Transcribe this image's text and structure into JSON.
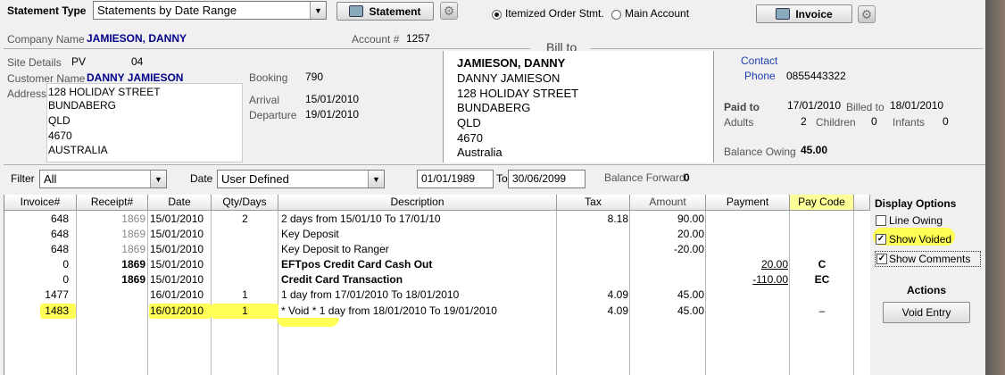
{
  "top": {
    "statement_type_label": "Statement Type",
    "statement_type_value": "Statements by Date Range",
    "statement_button": "Statement",
    "radio_itemized": "Itemized Order Stmt.",
    "radio_main": "Main Account",
    "invoice_button": "Invoice"
  },
  "company": {
    "label": "Company Name",
    "value": "JAMIESON, DANNY"
  },
  "account": {
    "label": "Account #",
    "value": "1257"
  },
  "bill_to_title": "Bill to",
  "site": {
    "label": "Site Details",
    "code": "PV",
    "number": "04"
  },
  "customer": {
    "label": "Customer Name",
    "value": "DANNY JAMIESON"
  },
  "address": {
    "label": "Address",
    "lines": [
      "128 HOLIDAY STREET",
      "BUNDABERG",
      "QLD",
      "4670",
      "AUSTRALIA"
    ]
  },
  "booking": {
    "label": "Booking",
    "value": "790"
  },
  "arrival": {
    "label": "Arrival",
    "value": "15/01/2010"
  },
  "departure": {
    "label": "Departure",
    "value": "19/01/2010"
  },
  "bill_to": {
    "name": "JAMIESON, DANNY",
    "lines": [
      "DANNY JAMIESON",
      "128 HOLIDAY STREET",
      "BUNDABERG",
      "QLD",
      "4670",
      "Australia"
    ]
  },
  "contact": {
    "label": "Contact",
    "phone_label": "Phone",
    "phone": "0855443322"
  },
  "paid": {
    "paid_to_label": "Paid to",
    "paid_to": "17/01/2010",
    "billed_to_label": "Billed to",
    "billed_to": "18/01/2010",
    "adults_label": "Adults",
    "adults": "2",
    "children_label": "Children",
    "children": "0",
    "infants_label": "Infants",
    "infants": "0",
    "balance_owing_label": "Balance Owing",
    "balance_owing": "45.00"
  },
  "filter": {
    "label": "Filter",
    "value": "All",
    "date_label": "Date",
    "date_value": "User Defined",
    "from": "01/01/1989",
    "to_label": "To",
    "to": "30/06/2099",
    "balance_forward_label": "Balance Forward",
    "balance_forward": "0"
  },
  "table": {
    "headers": [
      "Invoice#",
      "Receipt#",
      "Date",
      "Qty/Days",
      "Description",
      "Tax",
      "Amount",
      "Payment",
      "Pay Code"
    ],
    "rows": [
      {
        "invoice": "648",
        "receipt": "1869",
        "date": "15/01/2010",
        "qty": "2",
        "desc": "2 days from 15/01/10 To 17/01/10",
        "tax": "8.18",
        "amount": "90.00",
        "payment": "",
        "paycode": ""
      },
      {
        "invoice": "648",
        "receipt": "1869",
        "date": "15/01/2010",
        "qty": "",
        "desc": "Key Deposit",
        "tax": "",
        "amount": "20.00",
        "payment": "",
        "paycode": ""
      },
      {
        "invoice": "648",
        "receipt": "1869",
        "date": "15/01/2010",
        "qty": "",
        "desc": "Key Deposit to Ranger",
        "tax": "",
        "amount": "-20.00",
        "payment": "",
        "paycode": ""
      },
      {
        "invoice": "0",
        "receipt": "1869",
        "date": "15/01/2010",
        "qty": "",
        "desc": "EFTpos Credit Card Cash Out",
        "tax": "",
        "amount": "",
        "payment": "20.00",
        "paycode": "C"
      },
      {
        "invoice": "0",
        "receipt": "1869",
        "date": "15/01/2010",
        "qty": "",
        "desc": "Credit Card Transaction",
        "tax": "",
        "amount": "",
        "payment": "-110.00",
        "paycode": "EC"
      },
      {
        "invoice": "1477",
        "receipt": "",
        "date": "16/01/2010",
        "qty": "1",
        "desc": "1 day from 17/01/2010 To 18/01/2010",
        "tax": "4.09",
        "amount": "45.00",
        "payment": "",
        "paycode": ""
      },
      {
        "invoice": "1483",
        "receipt": "",
        "date": "16/01/2010",
        "qty": "1",
        "desc": "* Void * 1 day from 18/01/2010 To 19/01/2010",
        "tax": "4.09",
        "amount": "45.00",
        "payment": "",
        "paycode": "–"
      }
    ]
  },
  "display_options": {
    "title": "Display Options",
    "line_owing": "Line Owing",
    "show_voided": "Show Voided",
    "show_comments": "Show  Comments",
    "actions_title": "Actions",
    "void_entry": "Void Entry"
  },
  "colors": {
    "highlight": "#ffff55",
    "blue_text": "#00008b"
  }
}
